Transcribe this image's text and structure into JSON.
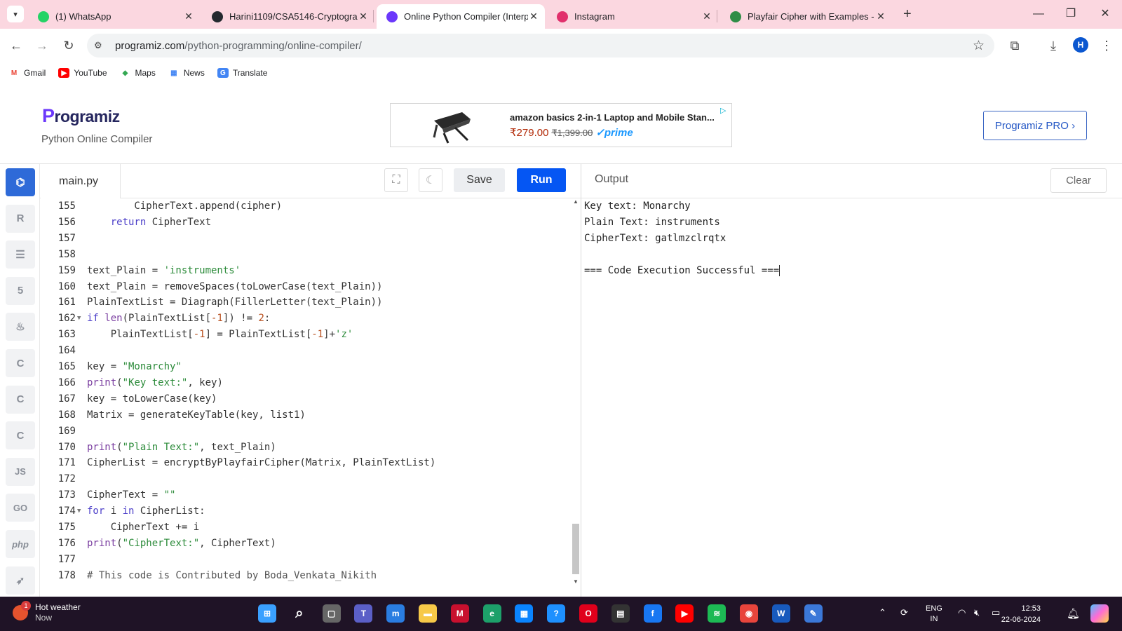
{
  "browser": {
    "tabs": [
      {
        "title": "(1) WhatsApp",
        "icon": "whatsapp-icon",
        "color": "#25d366"
      },
      {
        "title": "Harini1109/CSA5146-Cryptogra",
        "icon": "github-icon",
        "color": "#24292f"
      },
      {
        "title": "Online Python Compiler (Interp",
        "icon": "programiz-icon",
        "color": "#6b38fb"
      },
      {
        "title": "Instagram",
        "icon": "instagram-icon",
        "color": "#e1306c"
      },
      {
        "title": "Playfair Cipher with Examples -",
        "icon": "gfg-icon",
        "color": "#2f8d46"
      }
    ],
    "url_host": "programiz.com",
    "url_path": "/python-programming/online-compiler/",
    "profile_initial": "H",
    "bookmarks": [
      {
        "label": "Gmail",
        "icon": "gmail-icon"
      },
      {
        "label": "YouTube",
        "icon": "youtube-icon"
      },
      {
        "label": "Maps",
        "icon": "maps-icon"
      },
      {
        "label": "News",
        "icon": "news-icon"
      },
      {
        "label": "Translate",
        "icon": "translate-icon"
      }
    ]
  },
  "page": {
    "logo": "Programiz",
    "subtitle": "Python Online Compiler",
    "ad": {
      "title": "amazon basics 2-in-1 Laptop and Mobile Stan...",
      "price": "₹279.00",
      "old_price": "₹1,399.00",
      "prime": "prime"
    },
    "pro_button": "Programiz PRO ›"
  },
  "editor": {
    "filename": "main.py",
    "save_label": "Save",
    "run_label": "Run",
    "output_label": "Output",
    "clear_label": "Clear",
    "sidebar": [
      "python-icon",
      "r-icon",
      "database-icon",
      "html-icon",
      "java-icon",
      "c-icon",
      "cpp-icon",
      "csharp-icon",
      "JS",
      "GO",
      "php",
      "swift-icon"
    ],
    "lines": [
      {
        "n": "155",
        "t": "        CipherText.append(cipher)"
      },
      {
        "n": "156",
        "t": "    return CipherText"
      },
      {
        "n": "157",
        "t": ""
      },
      {
        "n": "158",
        "t": ""
      },
      {
        "n": "159",
        "t": "text_Plain = 'instruments'"
      },
      {
        "n": "160",
        "t": "text_Plain = removeSpaces(toLowerCase(text_Plain))"
      },
      {
        "n": "161",
        "t": "PlainTextList = Diagraph(FillerLetter(text_Plain))"
      },
      {
        "n": "162",
        "t": "if len(PlainTextList[-1]) != 2:",
        "fold": true
      },
      {
        "n": "163",
        "t": "    PlainTextList[-1] = PlainTextList[-1]+'z'"
      },
      {
        "n": "164",
        "t": ""
      },
      {
        "n": "165",
        "t": "key = \"Monarchy\""
      },
      {
        "n": "166",
        "t": "print(\"Key text:\", key)"
      },
      {
        "n": "167",
        "t": "key = toLowerCase(key)"
      },
      {
        "n": "168",
        "t": "Matrix = generateKeyTable(key, list1)"
      },
      {
        "n": "169",
        "t": ""
      },
      {
        "n": "170",
        "t": "print(\"Plain Text:\", text_Plain)"
      },
      {
        "n": "171",
        "t": "CipherList = encryptByPlayfairCipher(Matrix, PlainTextList)"
      },
      {
        "n": "172",
        "t": ""
      },
      {
        "n": "173",
        "t": "CipherText = \"\""
      },
      {
        "n": "174",
        "t": "for i in CipherList:",
        "fold": true
      },
      {
        "n": "175",
        "t": "    CipherText += i"
      },
      {
        "n": "176",
        "t": "print(\"CipherText:\", CipherText)"
      },
      {
        "n": "177",
        "t": ""
      },
      {
        "n": "178",
        "t": "# This code is Contributed by Boda_Venkata_Nikith"
      }
    ],
    "output_lines": [
      "Key text: Monarchy",
      "Plain Text: instruments",
      "CipherText: gatlmzclrqtx",
      "",
      "=== Code Execution Successful ==="
    ]
  },
  "taskbar": {
    "weather_title": "Hot weather",
    "weather_sub": "Now",
    "weather_badge": "1",
    "apps": [
      "windows-start-icon",
      "search-icon",
      "task-view-icon",
      "teams-icon",
      "mylp-icon",
      "file-explorer-icon",
      "mcafee-icon",
      "edge-icon",
      "store-icon",
      "help-icon",
      "opera-icon",
      "app-icon",
      "facebook-icon",
      "youtube-icon",
      "spotify-icon",
      "chrome-icon",
      "word-icon",
      "notepad-icon"
    ],
    "lang_top": "ENG",
    "lang_bottom": "IN",
    "time": "12:53",
    "date": "22-06-2024"
  }
}
